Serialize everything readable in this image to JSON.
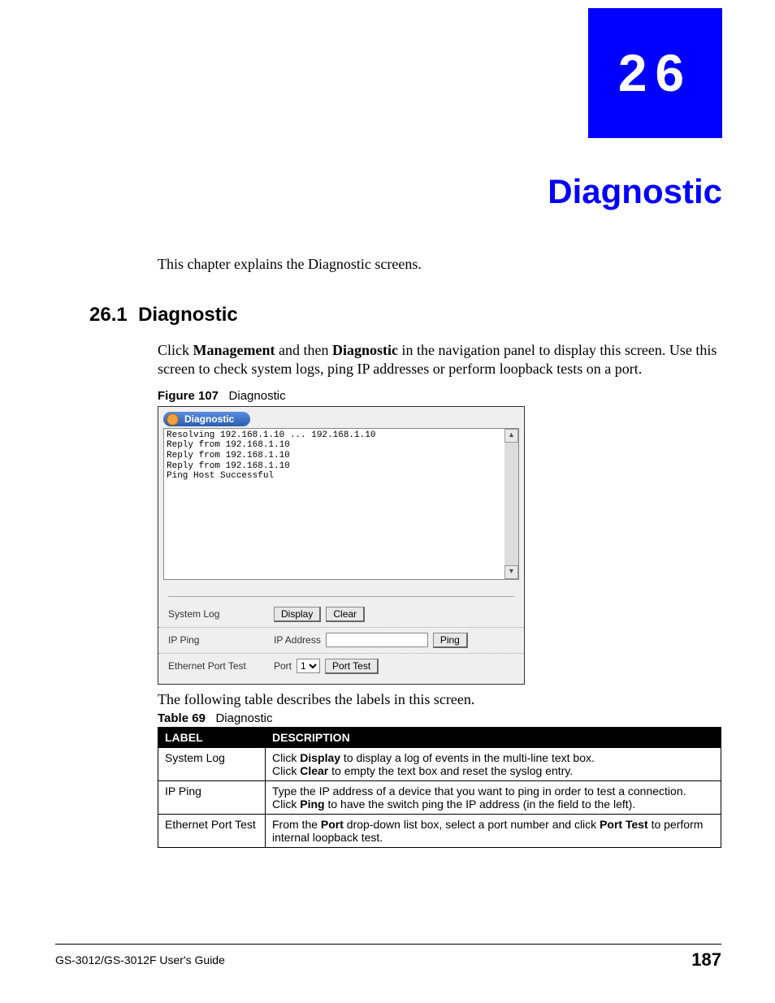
{
  "chapter": {
    "number": "26",
    "title": "Diagnostic"
  },
  "intro": "This chapter explains the Diagnostic screens.",
  "section": {
    "number": "26.1",
    "title": "Diagnostic",
    "body_pre": "Click ",
    "body_b1": "Management",
    "body_mid1": " and then ",
    "body_b2": "Diagnostic",
    "body_mid2": " in the navigation panel to display this screen. Use this screen to check system logs, ping IP addresses or perform loopback tests on a port."
  },
  "figure": {
    "label": "Figure 107",
    "caption": "Diagnostic",
    "tab_title": "Diagnostic",
    "log_text": "Resolving 192.168.1.10 ... 192.168.1.10\nReply from 192.168.1.10\nReply from 192.168.1.10\nReply from 192.168.1.10\nPing Host Successful",
    "rows": {
      "syslog_label": "System Log",
      "display_btn": "Display",
      "clear_btn": "Clear",
      "ipping_label": "IP Ping",
      "ipaddr_label": "IP Address",
      "ping_btn": "Ping",
      "eth_label": "Ethernet Port Test",
      "port_label": "Port",
      "port_value": "1",
      "porttest_btn": "Port Test"
    }
  },
  "after_figure": "The following table describes the labels in this screen.",
  "table": {
    "label": "Table 69",
    "caption": "Diagnostic",
    "headers": {
      "c1": "LABEL",
      "c2": "DESCRIPTION"
    },
    "rows": [
      {
        "label": "System Log",
        "d1a": "Click ",
        "d1b": "Display",
        "d1c": " to display a log of events in the multi-line text box.",
        "d2a": "Click ",
        "d2b": "Clear",
        "d2c": " to empty the text box and reset the syslog entry."
      },
      {
        "label": "IP Ping",
        "d1a": "Type the IP address of a device that you want to ping in order to test a connection.",
        "d2a": "Click ",
        "d2b": "Ping",
        "d2c": " to have the switch ping the IP address (in the field to the left)."
      },
      {
        "label": "Ethernet Port Test",
        "d1a": "From the ",
        "d1b": "Port",
        "d1c": " drop-down list box, select a port number and click ",
        "d1d": "Port Test",
        "d1e": " to perform internal loopback test."
      }
    ]
  },
  "footer": {
    "guide": "GS-3012/GS-3012F User's Guide",
    "page": "187"
  }
}
